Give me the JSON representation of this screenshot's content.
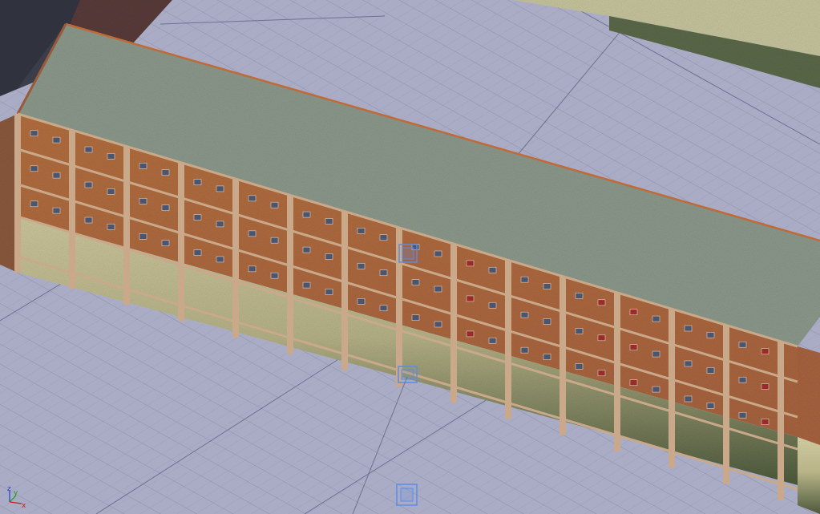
{
  "viewport": {
    "background": "#a9acc4",
    "grid_color": "#8d91ab",
    "grid_major_color": "#6e7290"
  },
  "axes_gizmo": {
    "x_label": "x",
    "y_label": "y",
    "z_label": "z",
    "x_color": "#d01818",
    "y_color": "#18a018",
    "z_color": "#2040d0"
  },
  "scene": {
    "roof_color": "#8a9a8c",
    "facade_brick_color": "#b06a43",
    "ground_floor_color": "#c8c39a",
    "plinth_color": "#5d6a4a",
    "pillar_color": "#c9a98a",
    "trim_color": "#c06a3a",
    "pivot_color": "#5a8ce6"
  }
}
